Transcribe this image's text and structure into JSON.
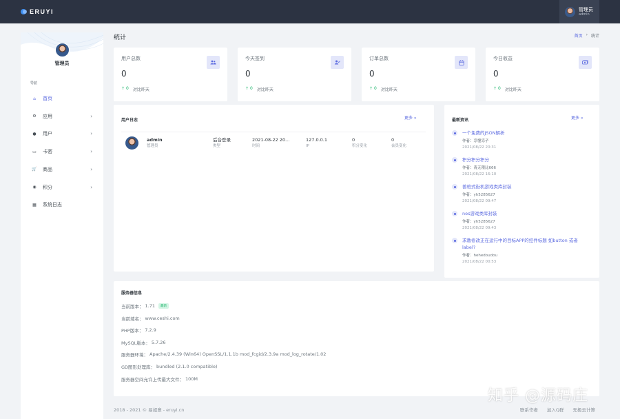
{
  "topbar": {
    "logo_text": "ERUYI",
    "user_name": "管理员",
    "user_role": "admin"
  },
  "sidebar": {
    "name": "管理员",
    "nav_heading": "导航",
    "items": [
      {
        "label": "首页",
        "icon": "home-icon",
        "active": true,
        "has_children": false
      },
      {
        "label": "应用",
        "icon": "settings-icon",
        "active": false,
        "has_children": true
      },
      {
        "label": "用户",
        "icon": "user-icon",
        "active": false,
        "has_children": true
      },
      {
        "label": "卡密",
        "icon": "card-icon",
        "active": false,
        "has_children": true
      },
      {
        "label": "商品",
        "icon": "cart-icon",
        "active": false,
        "has_children": true
      },
      {
        "label": "积分",
        "icon": "points-icon",
        "active": false,
        "has_children": true
      },
      {
        "label": "系统日志",
        "icon": "calendar-icon",
        "active": false,
        "has_children": false
      }
    ]
  },
  "header": {
    "title": "统计",
    "breadcrumb": [
      "首页",
      "›",
      "统计"
    ]
  },
  "stats": [
    {
      "title": "用户总数",
      "value": "0",
      "up_value": "0",
      "compare": "对比昨天",
      "icon": "users-icon"
    },
    {
      "title": "今天签到",
      "value": "0",
      "up_value": "0",
      "compare": "对比昨天",
      "icon": "user-check-icon"
    },
    {
      "title": "订单总数",
      "value": "0",
      "up_value": "0",
      "compare": "对比昨天",
      "icon": "calendar-icon"
    },
    {
      "title": "今日收益",
      "value": "0",
      "up_value": "0",
      "compare": "对比昨天",
      "icon": "money-icon"
    }
  ],
  "user_log": {
    "title": "用户日志",
    "more": "更多 »",
    "row": {
      "name": "admin",
      "role": "管理员",
      "type_value": "后台登录",
      "type_label": "类型",
      "time_value": "2021-08-22 20...",
      "time_label": "时间",
      "ip_value": "127.0.0.1",
      "ip_label": "IP",
      "points_value": "0",
      "points_label": "积分变化",
      "member_value": "0",
      "member_label": "会员变化"
    }
  },
  "news": {
    "title": "最新资讯",
    "more": "更多 »",
    "items": [
      {
        "title": "一个免费的JSON解析",
        "author": "作者：凉憧凉子",
        "date": "2021/08/22 20:31"
      },
      {
        "title": "积分积分积分",
        "author": "作者：青无限比666",
        "date": "2021/08/22 16:10"
      },
      {
        "title": "兽棺式街机游戏类库封装",
        "author": "作者：yh5285627",
        "date": "2021/08/22 09:47"
      },
      {
        "title": "nes游戏类库封装",
        "author": "作者：yh5285627",
        "date": "2021/08/22 09:43"
      },
      {
        "title": "求教修改正在运行中的目标APP的控件标题 如button 或者 label?",
        "author": "作者：hehedoudou",
        "date": "2021/08/22 00:53"
      }
    ]
  },
  "server": {
    "title": "服务器信息",
    "lines": [
      {
        "label": "当前版本：",
        "value": "1.71",
        "badge": "最新"
      },
      {
        "label": "当前域名：",
        "value": "www.ceshi.com"
      },
      {
        "label": "PHP版本：",
        "value": "7.2.9"
      },
      {
        "label": "MySQL版本：",
        "value": "5.7.26"
      },
      {
        "label": "服务器环境：",
        "value": "Apache/2.4.39 (Win64) OpenSSL/1.1.1b mod_fcgid/2.3.9a mod_log_rotate/1.02"
      },
      {
        "label": "GD图形处理库：",
        "value": "bundled (2.1.0 compatible)"
      },
      {
        "label": "服务器空间允许上传最大文件：",
        "value": "100M"
      }
    ]
  },
  "footer": {
    "copyright": "2018 - 2021 © 易如意 - eruyi.cn",
    "links": [
      "联系作者",
      "加入Q群",
      "无极云计算"
    ]
  },
  "watermark": "知乎 @源码庄"
}
